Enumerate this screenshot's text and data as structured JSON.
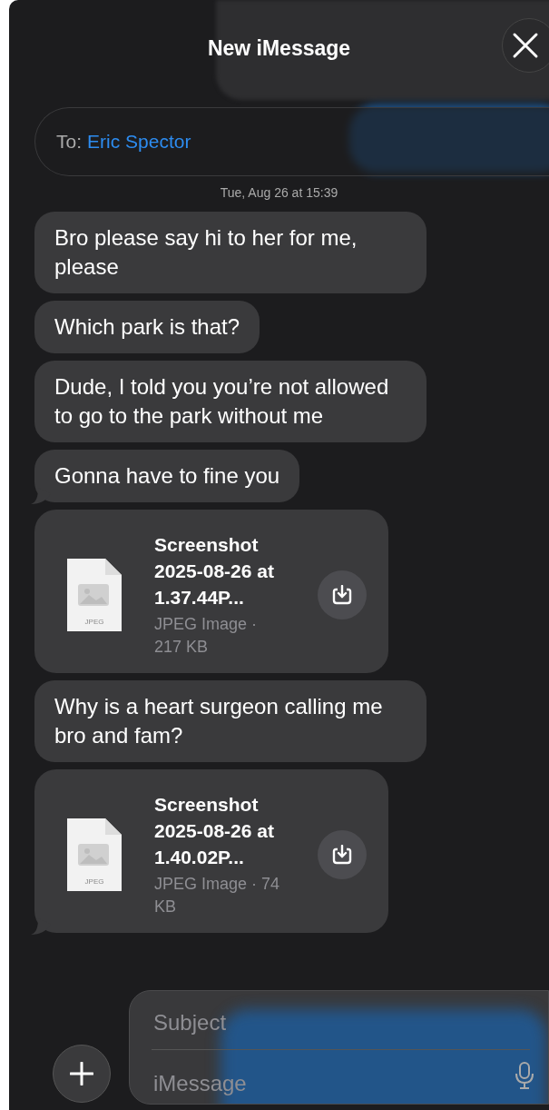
{
  "header": {
    "title": "New iMessage"
  },
  "to_field": {
    "label": "To:",
    "recipient": "Eric Spector"
  },
  "timestamp": "Tue, Aug 26 at 15:39",
  "messages": [
    {
      "kind": "text",
      "text": "Bro please say hi to her for me, please",
      "tail": false
    },
    {
      "kind": "text",
      "text": "Which park is that?",
      "tail": false
    },
    {
      "kind": "text",
      "text": "Dude, I told you you’re not allowed to go to the park without me",
      "tail": false
    },
    {
      "kind": "text",
      "text": "Gonna have to fine you",
      "tail": true
    },
    {
      "kind": "file",
      "name": "Screenshot 2025-08-26 at 1.37.44P...",
      "file_type": "JPEG",
      "meta": "JPEG Image · 217 KB",
      "tail": false
    },
    {
      "kind": "text",
      "text": "Why is a heart surgeon calling me bro and fam?",
      "tail": false
    },
    {
      "kind": "file",
      "name": "Screenshot 2025-08-26 at 1.40.02P...",
      "file_type": "JPEG",
      "meta": "JPEG Image · 74 KB",
      "tail": true
    }
  ],
  "compose": {
    "subject_placeholder": "Subject",
    "message_placeholder": "iMessage"
  }
}
